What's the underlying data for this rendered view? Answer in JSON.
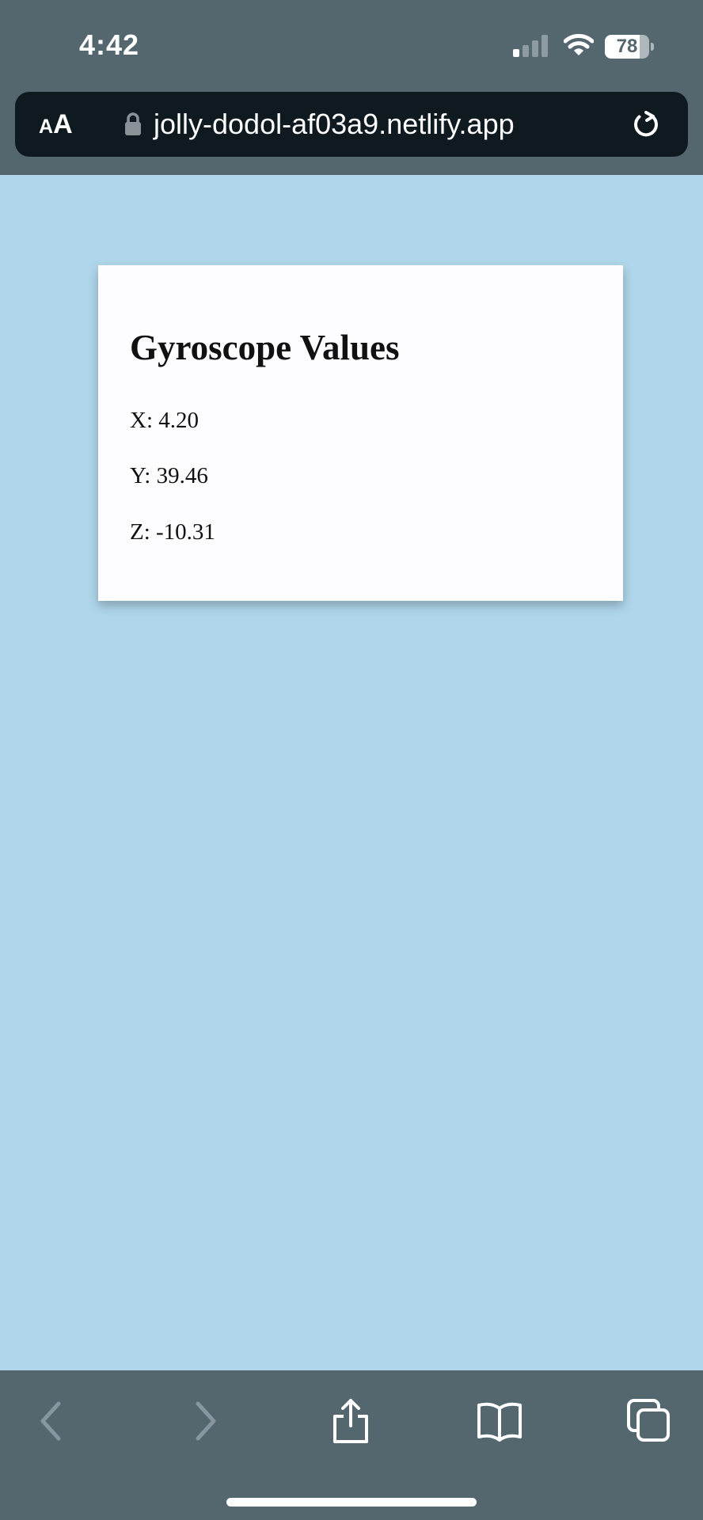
{
  "status_bar": {
    "time": "4:42",
    "battery_level": "78",
    "battery_fraction": 0.78,
    "signal_bars_active": 1,
    "signal_bars_total": 4
  },
  "browser": {
    "text_size_button": {
      "small": "A",
      "large": "A"
    },
    "url": "jolly-dodol-af03a9.netlify.app",
    "icons": {
      "lock": "lock-icon",
      "reload": "reload-icon",
      "back": "chevron-left-icon",
      "forward": "chevron-right-icon",
      "share": "share-icon",
      "bookmarks": "book-icon",
      "tabs": "tabs-icon"
    },
    "back_enabled": false,
    "forward_enabled": false
  },
  "page": {
    "background_color": "#afd6ea",
    "card": {
      "title": "Gyroscope Values",
      "x_line": "X: 4.20",
      "y_line": "Y: 39.46",
      "z_line": "Z: -10.31"
    }
  },
  "colors": {
    "chrome": "#54666e",
    "address_bar": "#0e1a20",
    "card": "#fdfdff"
  }
}
